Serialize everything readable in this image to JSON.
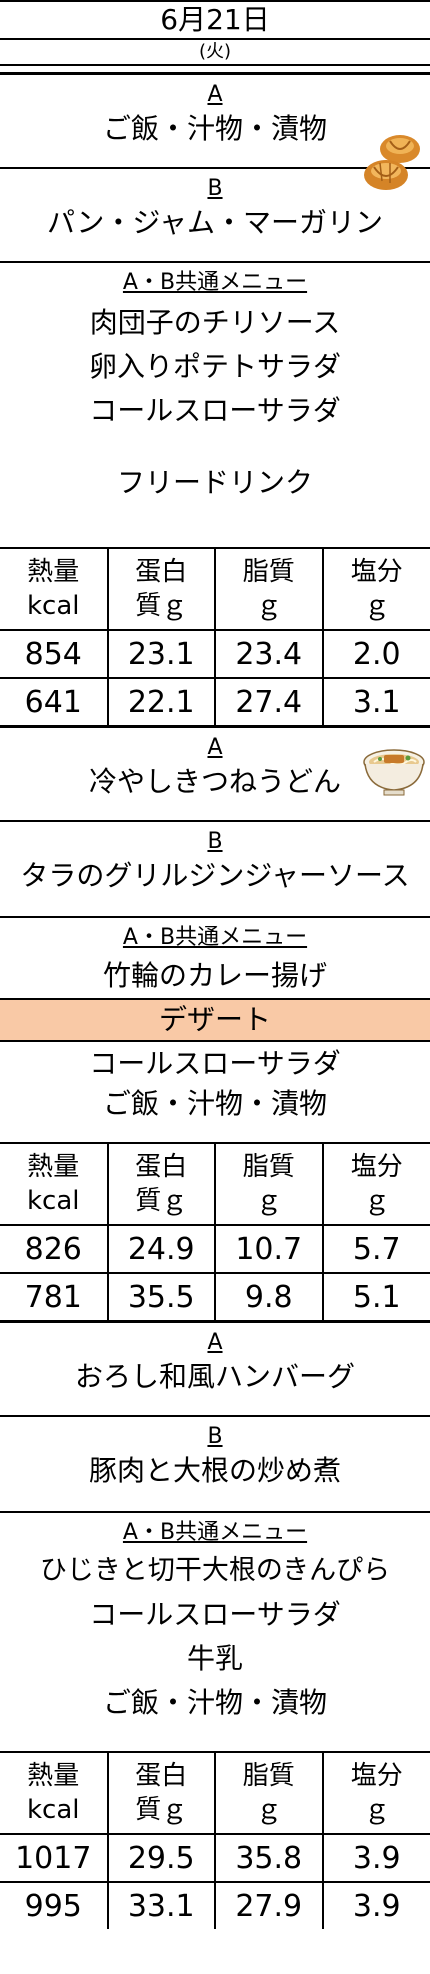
{
  "header": {
    "date": "6月21日",
    "day": "(火)"
  },
  "meals": [
    {
      "a_label": "A",
      "a_items": [
        "ご飯・汁物・漬物"
      ],
      "b_label": "B",
      "b_items": [
        "パン・ジャム・マーガリン"
      ],
      "common_label": "A・B共通メニュー",
      "common_items": [
        "肉団子のチリソース",
        "卵入りポテトサラダ",
        "コールスローサラダ",
        "",
        "フリードリンク"
      ],
      "nutrition": {
        "headers": [
          [
            "熱量",
            "kcal"
          ],
          [
            "蛋白",
            "質ｇ"
          ],
          [
            "脂質",
            "ｇ"
          ],
          [
            "塩分",
            "ｇ"
          ]
        ],
        "rows": [
          [
            "854",
            "23.1",
            "23.4",
            "2.0"
          ],
          [
            "641",
            "22.1",
            "27.4",
            "3.1"
          ]
        ]
      },
      "icon": "bread-icon"
    },
    {
      "a_label": "A",
      "a_items": [
        "冷やしきつねうどん"
      ],
      "b_label": "B",
      "b_items": [
        "タラのグリルジンジャーソース"
      ],
      "common_label": "A・B共通メニュー",
      "common_items": [
        "竹輪のカレー揚げ",
        "デザート",
        "コールスローサラダ",
        "ご飯・汁物・漬物"
      ],
      "nutrition": {
        "headers": [
          [
            "熱量",
            "kcal"
          ],
          [
            "蛋白",
            "質ｇ"
          ],
          [
            "脂質",
            "ｇ"
          ],
          [
            "塩分",
            "ｇ"
          ]
        ],
        "rows": [
          [
            "826",
            "24.9",
            "10.7",
            "5.7"
          ],
          [
            "781",
            "35.5",
            "9.8",
            "5.1"
          ]
        ]
      },
      "icon": "udon-icon"
    },
    {
      "a_label": "A",
      "a_items": [
        "おろし和風ハンバーグ"
      ],
      "b_label": "B",
      "b_items": [
        "豚肉と大根の炒め煮"
      ],
      "common_label": "A・B共通メニュー",
      "common_items": [
        "ひじきと切干大根のきんぴら",
        "コールスローサラダ",
        "牛乳",
        "ご飯・汁物・漬物"
      ],
      "nutrition": {
        "headers": [
          [
            "熱量",
            "kcal"
          ],
          [
            "蛋白",
            "質ｇ"
          ],
          [
            "脂質",
            "ｇ"
          ],
          [
            "塩分",
            "ｇ"
          ]
        ],
        "rows": [
          [
            "1017",
            "29.5",
            "35.8",
            "3.9"
          ],
          [
            "995",
            "33.1",
            "27.9",
            "3.9"
          ]
        ]
      }
    }
  ],
  "colors": {
    "highlight": "#f9c9a6",
    "border": "#000000"
  }
}
